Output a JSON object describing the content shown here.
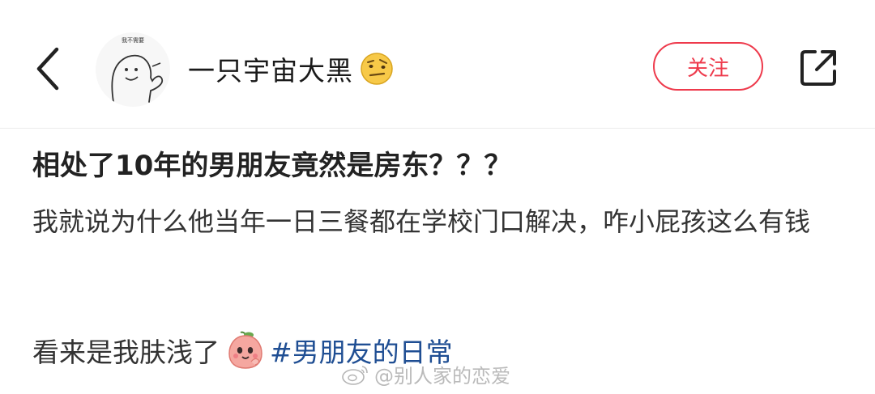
{
  "header": {
    "avatar_caption": "我不需要",
    "username": "一只宇宙大黑",
    "follow_label": "关注"
  },
  "icons": {
    "back": "chevron-left-icon",
    "username_emoji": "smirk-face-icon",
    "share": "share-icon",
    "inline_emoji": "peach-face-icon",
    "watermark_logo": "weibo-icon"
  },
  "post": {
    "title": "相处了10年的男朋友竟然是房东？？？",
    "body": "我就说为什么他当年一日三餐都在学校门口解决，咋小屁孩这么有钱",
    "tail_text": "看来是我肤浅了",
    "hashtag": "#男朋友的日常"
  },
  "watermark": {
    "text": "@别人家的恋爱"
  },
  "colors": {
    "follow_accent": "#ee3a4c",
    "hashtag": "#1f4e93"
  }
}
